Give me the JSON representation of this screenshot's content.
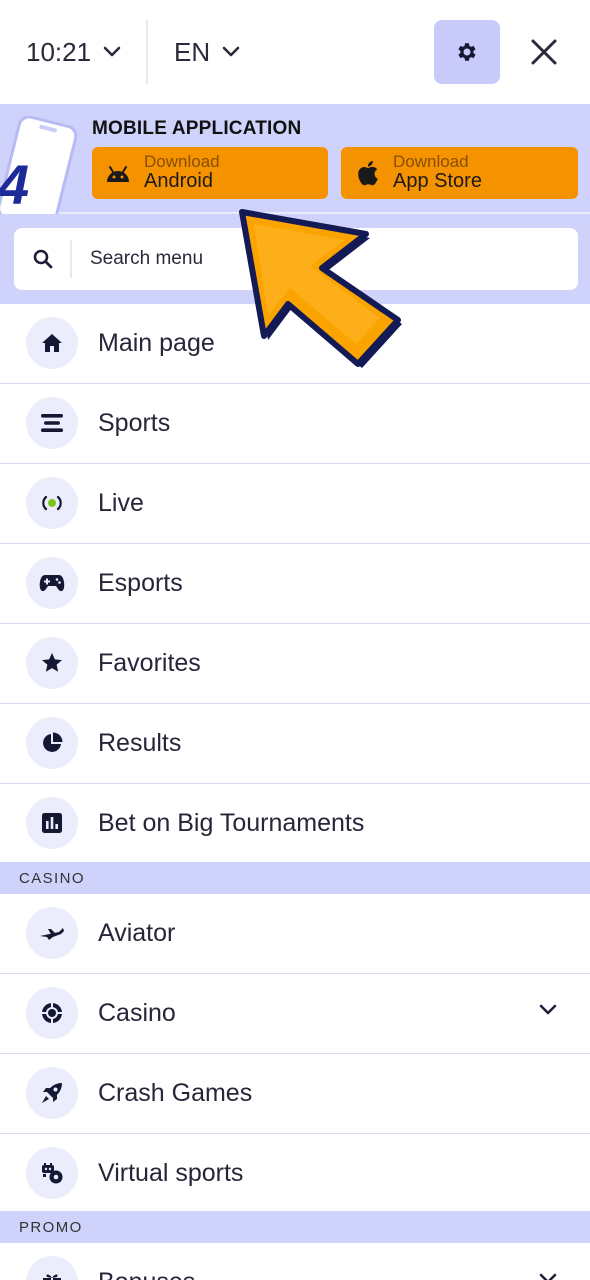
{
  "topbar": {
    "time": "10:21",
    "language": "EN",
    "settings_icon": "gear-icon",
    "close_icon": "close-icon"
  },
  "app_banner": {
    "title": "MOBILE APPLICATION",
    "logo_letter": "4",
    "android": {
      "small": "Download",
      "big": "Android",
      "icon": "android-icon"
    },
    "apple": {
      "small": "Download",
      "big": "App Store",
      "icon": "apple-icon"
    },
    "button_color": "#f59200"
  },
  "search": {
    "placeholder": "Search menu",
    "icon": "search-icon"
  },
  "menu": {
    "items": [
      {
        "label": "Main page",
        "icon": "home-icon"
      },
      {
        "label": "Sports",
        "icon": "sports-lines-icon"
      },
      {
        "label": "Live",
        "icon": "live-broadcast-icon"
      },
      {
        "label": "Esports",
        "icon": "gamepad-icon"
      },
      {
        "label": "Favorites",
        "icon": "star-icon"
      },
      {
        "label": "Results",
        "icon": "pie-chart-icon"
      },
      {
        "label": "Bet on Big Tournaments",
        "icon": "bar-chart-icon"
      }
    ],
    "section_casino": "CASINO",
    "casino_items": [
      {
        "label": "Aviator",
        "icon": "airplane-icon"
      },
      {
        "label": "Casino",
        "icon": "casino-chip-icon",
        "expandable": true
      },
      {
        "label": "Crash Games",
        "icon": "rocket-icon"
      },
      {
        "label": "Virtual sports",
        "icon": "virtual-sports-icon"
      }
    ],
    "section_promo": "PROMO",
    "promo_items": [
      {
        "label": "Bonuses",
        "icon": "gift-icon",
        "expandable": true
      }
    ]
  },
  "colors": {
    "accent_light": "#cfd3fb",
    "icon_bg": "#ebedfc",
    "pointer_fill": "#fba400",
    "pointer_stroke": "#131a55"
  }
}
